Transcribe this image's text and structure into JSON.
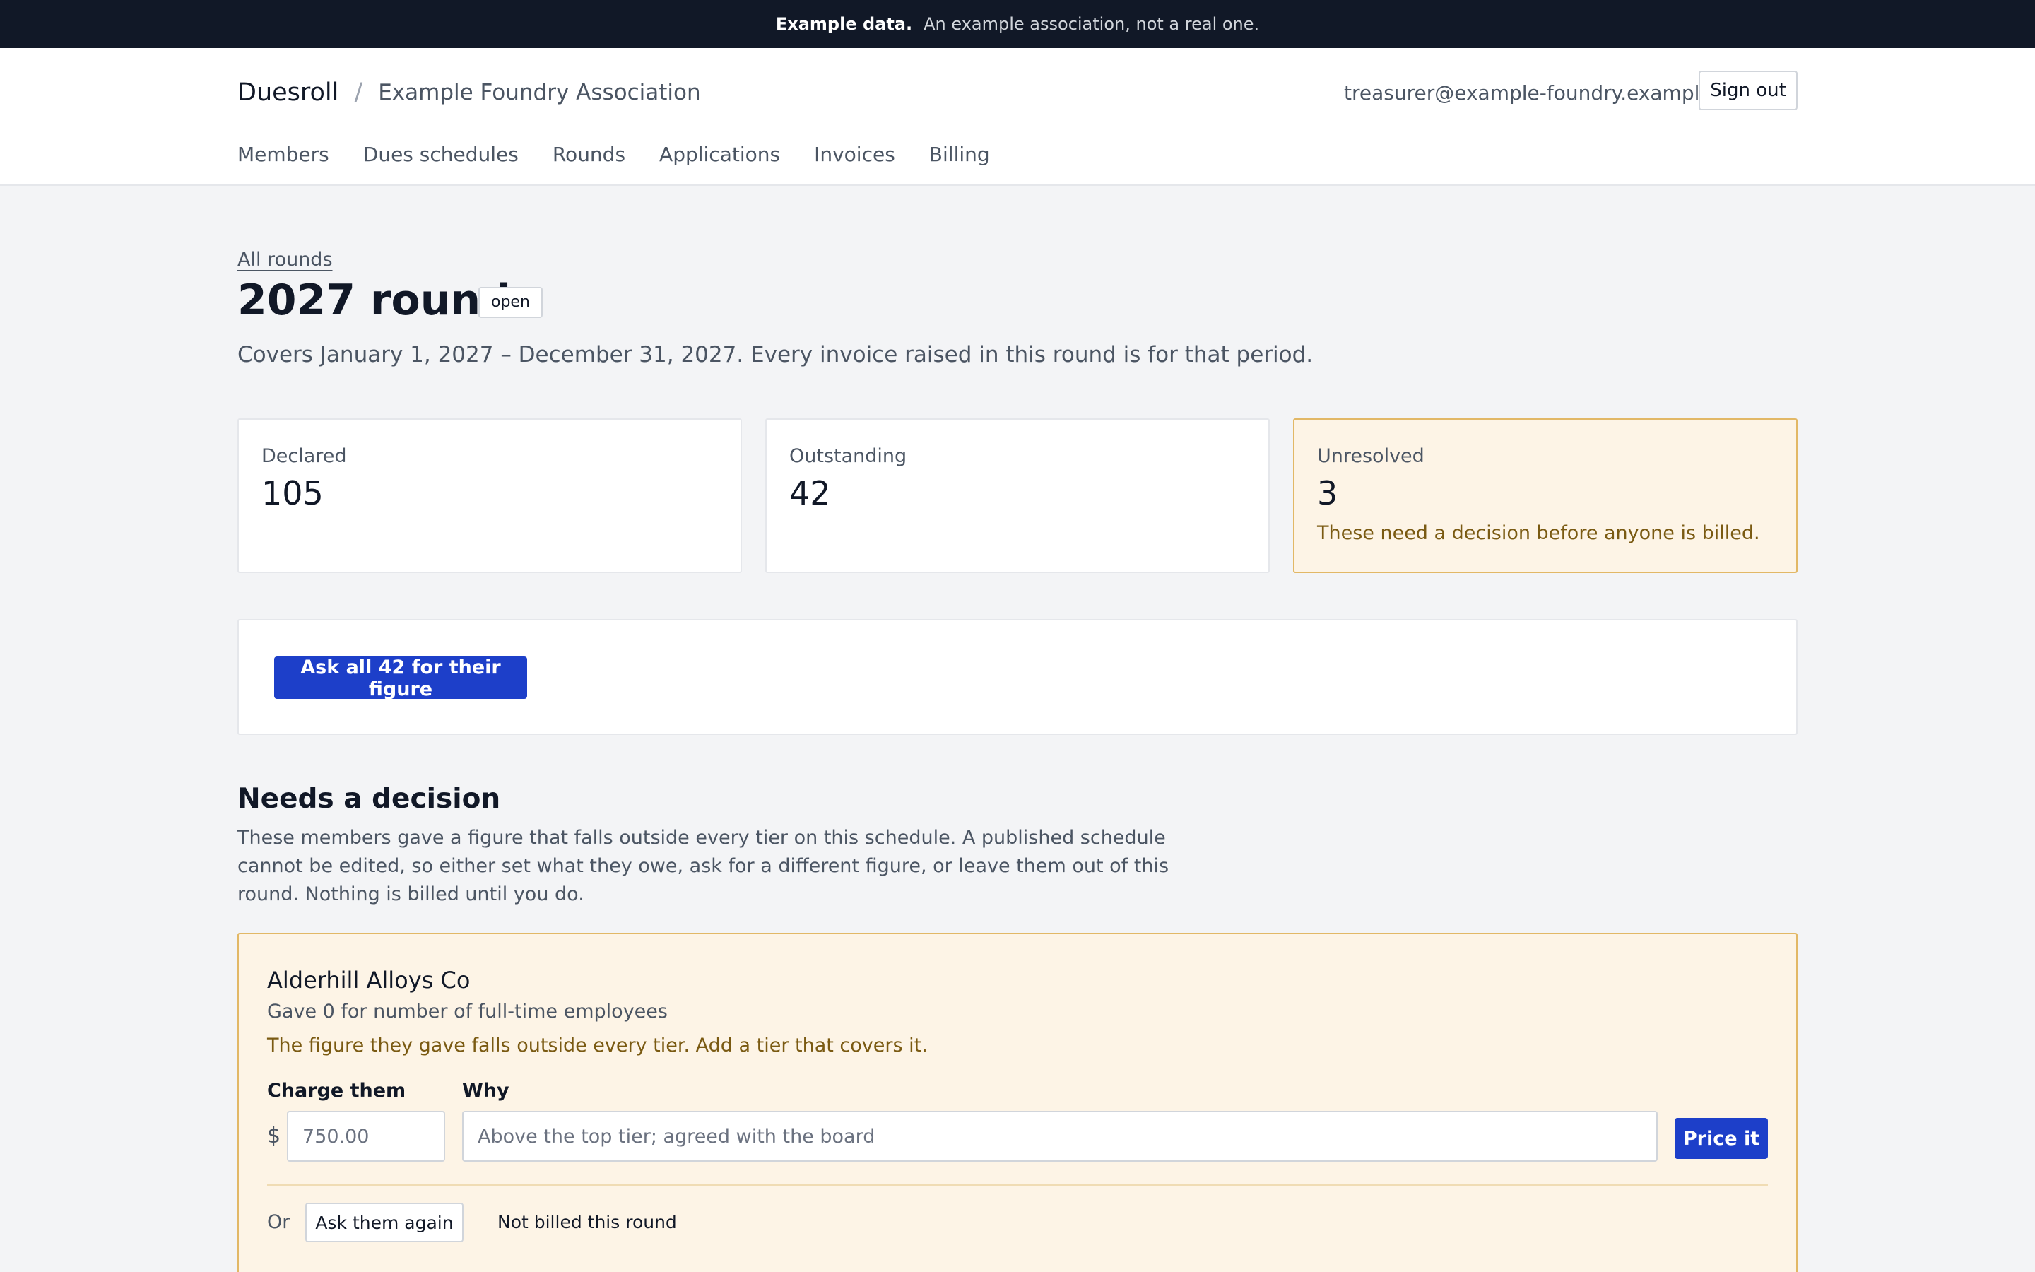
{
  "banner": {
    "strong": "Example data.",
    "text": "An example association, not a real one."
  },
  "header": {
    "app_name": "Duesroll",
    "separator": "/",
    "org_name": "Example Foundry Association",
    "user_email": "treasurer@example-foundry.example",
    "sign_out_label": "Sign out"
  },
  "nav": {
    "items": [
      {
        "label": "Members"
      },
      {
        "label": "Dues schedules"
      },
      {
        "label": "Rounds"
      },
      {
        "label": "Applications"
      },
      {
        "label": "Invoices"
      },
      {
        "label": "Billing"
      }
    ]
  },
  "page": {
    "breadcrumb": "All rounds",
    "title": "2027 round",
    "status_badge": "open",
    "period_text": "Covers January 1, 2027 – December 31, 2027. Every invoice raised in this round is for that period."
  },
  "stats": [
    {
      "label": "Declared",
      "value": "105"
    },
    {
      "label": "Outstanding",
      "value": "42"
    },
    {
      "label": "Unresolved",
      "value": "3",
      "note": "These need a decision before anyone is billed."
    }
  ],
  "ask_all_label": "Ask all 42 for their figure",
  "decision_section": {
    "title": "Needs a decision",
    "description": "These members gave a figure that falls outside every tier on this schedule. A published schedule cannot be edited, so either set what they owe, ask for a different figure, or leave them out of this round. Nothing is billed until you do."
  },
  "decision_card": {
    "member_name": "Alderhill Alloys Co",
    "gave_text": "Gave 0 for number of full-time employees",
    "problem_text": "The figure they gave falls outside every tier. Add a tier that covers it.",
    "charge_label": "Charge them",
    "currency_symbol": "$",
    "amount_placeholder": "750.00",
    "why_label": "Why",
    "why_placeholder": "Above the top tier; agreed with the board",
    "price_button": "Price it",
    "or_label": "Or",
    "ask_again_button": "Ask them again",
    "not_billed_button": "Not billed this round"
  },
  "colors": {
    "banner_bg": "#111827",
    "primary": "#1d3fc9",
    "warning_bg": "#fdf4e6",
    "warning_border": "#e2b866",
    "warning_text": "#7a5a12"
  }
}
